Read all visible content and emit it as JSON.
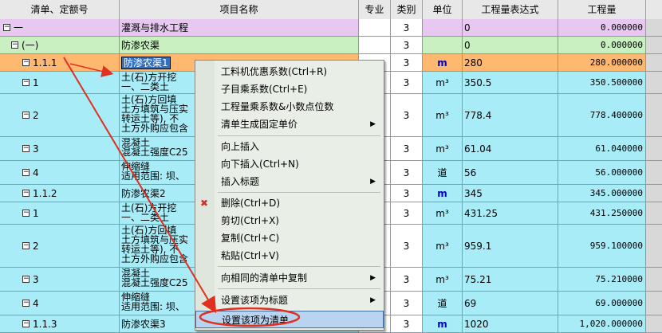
{
  "header": {
    "col_code": "清单、定额号",
    "col_name": "项目名称",
    "col_major": "专业",
    "col_type": "类别",
    "col_unit": "单位",
    "col_expr": "工程量表达式",
    "col_qty": "工程量"
  },
  "rows": [
    {
      "code": "一",
      "name": "灌溉与排水工程",
      "type": "3",
      "unit": "",
      "expr": "0",
      "qty": "0.000000",
      "toggle": "⊟"
    },
    {
      "code": "(一)",
      "name": "防渗农渠",
      "type": "3",
      "unit": "",
      "expr": "0",
      "qty": "0.000000",
      "toggle": "⊟"
    },
    {
      "code": "1.1.1",
      "name": "防渗农渠1",
      "type": "3",
      "unit": "m",
      "expr": "280",
      "qty": "280.000000",
      "toggle": "⊟"
    },
    {
      "code": "1",
      "name": "土(石)方开挖\n一、二类土",
      "type": "3",
      "unit": "m³",
      "expr": "350.5",
      "qty": "350.500000",
      "toggle": "⊟"
    },
    {
      "code": "2",
      "name": "土(石)方回填\n土方填筑与压实\n转运土等), 不\n土方外购应包含",
      "type": "3",
      "unit": "m³",
      "expr": "778.4",
      "qty": "778.400000",
      "toggle": "⊟"
    },
    {
      "code": "3",
      "name": "混凝土\n混凝土强度C25",
      "type": "3",
      "unit": "m³",
      "expr": "61.04",
      "qty": "61.040000",
      "toggle": "⊟"
    },
    {
      "code": "4",
      "name": "伸缩缝\n适用范围: 坝、",
      "type": "3",
      "unit": "道",
      "expr": "56",
      "qty": "56.000000",
      "toggle": "⊟"
    },
    {
      "code": "1.1.2",
      "name": "防渗农渠2",
      "type": "3",
      "unit": "m",
      "expr": "345",
      "qty": "345.000000",
      "toggle": "⊟"
    },
    {
      "code": "1",
      "name": "土(石)方开挖\n一、二类土",
      "type": "3",
      "unit": "m³",
      "expr": "431.25",
      "qty": "431.250000",
      "toggle": "⊟"
    },
    {
      "code": "2",
      "name": "土(石)方回填\n土方填筑与压实\n转运土等), 不\n土方外购应包含",
      "type": "3",
      "unit": "m³",
      "expr": "959.1",
      "qty": "959.100000",
      "toggle": "⊟"
    },
    {
      "code": "3",
      "name": "混凝土\n混凝土强度C25",
      "type": "3",
      "unit": "m³",
      "expr": "75.21",
      "qty": "75.210000",
      "toggle": "⊟"
    },
    {
      "code": "4",
      "name": "伸缩缝\n适用范围: 坝、",
      "type": "3",
      "unit": "道",
      "expr": "69",
      "qty": "69.000000",
      "toggle": "⊟"
    },
    {
      "code": "1.1.3",
      "name": "防渗农渠3",
      "type": "3",
      "unit": "m",
      "expr": "1020",
      "qty": "1,020.000000",
      "toggle": "⊟"
    }
  ],
  "menu": {
    "items": [
      {
        "label": "工料机优惠系数(Ctrl+R)",
        "submenu": false
      },
      {
        "label": "子目乘系数(Ctrl+E)",
        "submenu": false
      },
      {
        "label": "工程量乘系数&小数点位数",
        "submenu": false
      },
      {
        "label": "清单生成固定单价",
        "submenu": true
      },
      {
        "label": "向上插入",
        "submenu": false
      },
      {
        "label": "向下插入(Ctrl+N)",
        "submenu": false
      },
      {
        "label": "插入标题",
        "submenu": true
      },
      {
        "label": "删除(Ctrl+D)",
        "submenu": false
      },
      {
        "label": "剪切(Ctrl+X)",
        "submenu": false
      },
      {
        "label": "复制(Ctrl+C)",
        "submenu": false
      },
      {
        "label": "粘贴(Ctrl+V)",
        "submenu": false
      },
      {
        "label": "向相同的清单中复制",
        "submenu": true
      },
      {
        "label": "设置该项为标题",
        "submenu": true
      },
      {
        "label": "设置该项为清单",
        "submenu": false
      }
    ],
    "submenu_glyph": "▶",
    "delete_glyph": "✖"
  },
  "colors": {
    "row_group": "#e8c8f0",
    "row_sub": "#c8f0c0",
    "row_selected": "#ffb870",
    "row_item": "#a8ecf8",
    "unit_blue": "#0000c0",
    "annotation_red": "#e03020"
  }
}
